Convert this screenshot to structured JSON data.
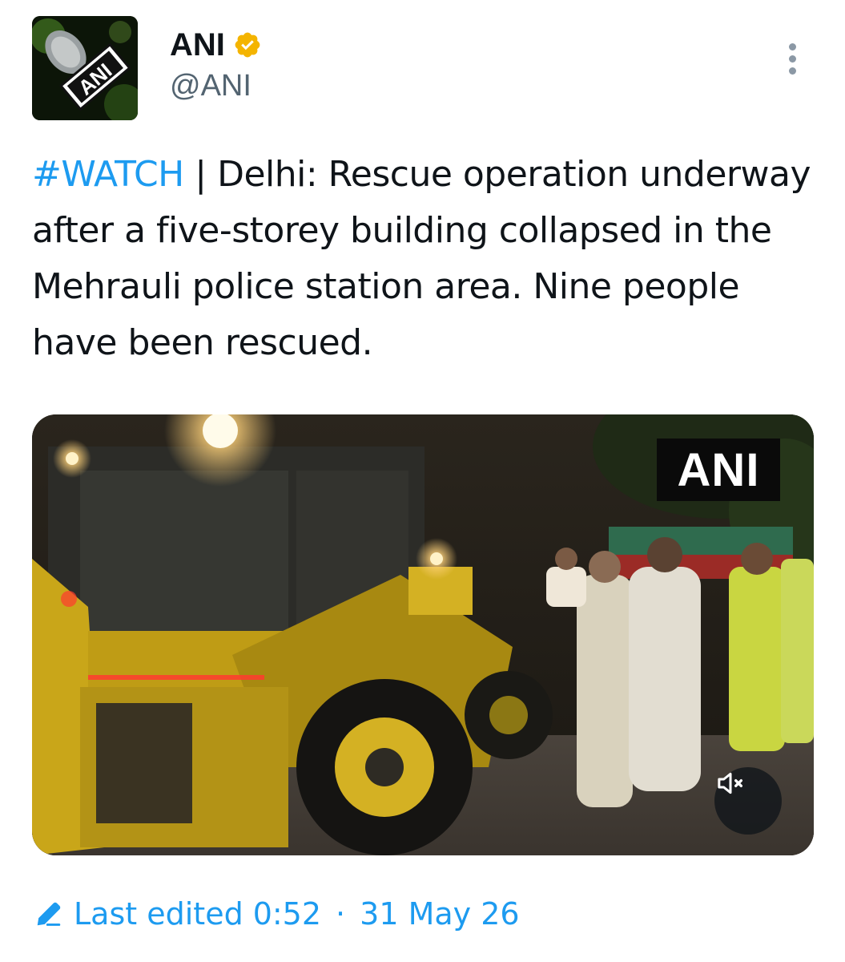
{
  "author": {
    "display_name": "ANI",
    "handle": "@ANI",
    "avatar_text": "ANI",
    "verified": true,
    "verified_color": "#f4b400"
  },
  "tweet": {
    "hashtag": "#WATCH",
    "separator": " | ",
    "text": "Delhi: Rescue operation underway after a five-storey building collapsed in the Mehrauli police station area. Nine people have been rescued."
  },
  "media": {
    "watermark": "ANI",
    "mute_icon": "speaker-muted-icon"
  },
  "footer": {
    "edited_label": "Last edited",
    "time": "0:52",
    "dot": "·",
    "date": "31 May 26",
    "icon": "pencil-icon"
  },
  "colors": {
    "accent": "#1d9bf0",
    "secondary_text": "#536471",
    "primary_text": "#0f1419"
  }
}
